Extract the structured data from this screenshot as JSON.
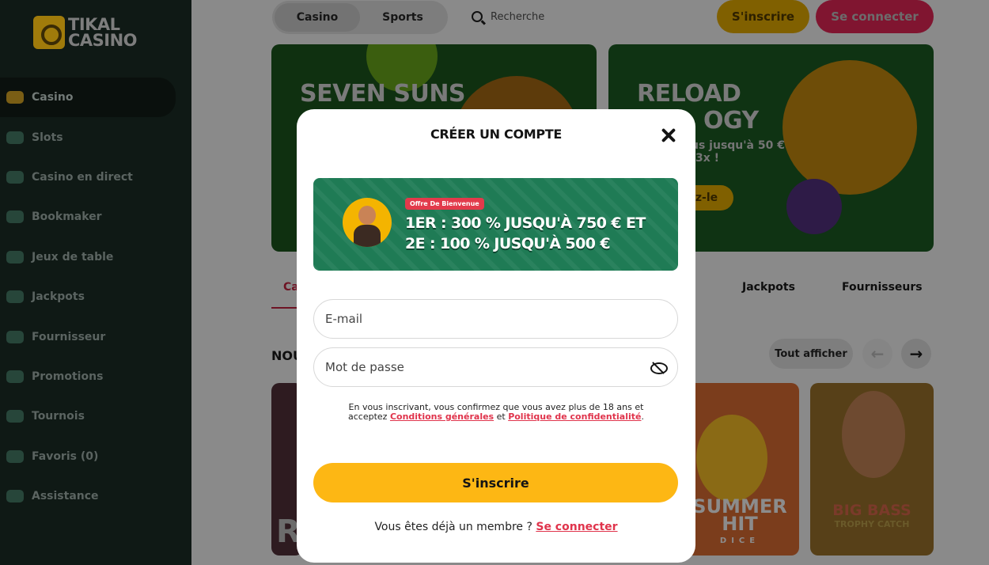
{
  "brand": {
    "logo_line1": "TIKAL",
    "logo_line2": "CASINO"
  },
  "sidebar": {
    "items": [
      {
        "label": "Casino",
        "icon": "slot-machine-icon",
        "active": true
      },
      {
        "label": "Slots",
        "icon": "slots-icon"
      },
      {
        "label": "Casino en direct",
        "icon": "live-casino-icon"
      },
      {
        "label": "Bookmaker",
        "icon": "football-icon"
      },
      {
        "label": "Jeux de table",
        "icon": "cards-icon"
      },
      {
        "label": "Jackpots",
        "icon": "jackpot-icon"
      },
      {
        "label": "Fournisseur",
        "icon": "provider-icon"
      },
      {
        "label": "Promotions",
        "icon": "promotions-icon"
      },
      {
        "label": "Tournois",
        "icon": "megaphone-icon"
      },
      {
        "label": "Favoris (0)",
        "icon": "megaphone-icon"
      },
      {
        "label": "Assistance",
        "icon": "chat-icon"
      }
    ]
  },
  "header": {
    "tabs": [
      "Casino",
      "Sports"
    ],
    "search_placeholder": "Recherche",
    "signup_label": "S'inscrire",
    "login_label": "Se connecter"
  },
  "banners": [
    {
      "title": "SEVEN SUNS"
    },
    {
      "title_line1": "RELOAD",
      "title_line2": "OGY",
      "sub_line1": "us jusqu'à 50 €",
      "sub_line2": "3x !",
      "button": "z-le"
    }
  ],
  "category_tabs": {
    "active_fragment": "Ca",
    "items": [
      "Jackpots",
      "Fournisseurs"
    ]
  },
  "section": {
    "title_fragment": "NOU",
    "see_all": "Tout afficher"
  },
  "games": [
    {
      "name": "R"
    },
    {
      "name_line1": "SUMMER",
      "name_line2": "HIT",
      "name_line3": "DICE"
    },
    {
      "name_line1": "BIG BASS",
      "name_line2": "TROPHY CATCH"
    }
  ],
  "modal": {
    "title": "CRÉER UN COMPTE",
    "promo": {
      "badge": "Offre De Bienvenue",
      "line1": "1ER : 300 % JUSQU'À 750 € ET",
      "line2": "2E : 100 % JUSQU'À 500 €"
    },
    "email_placeholder": "E-mail",
    "password_placeholder": "Mot de passe",
    "terms_before": "En vous inscrivant, vous confirmez que vous avez plus de 18 ans et acceptez ",
    "terms_link1": "Conditions générales",
    "terms_middle": " et ",
    "terms_link2": "Politique de confidentialité",
    "terms_after": ".",
    "submit_label": "S'inscrire",
    "member_text": "Vous êtes déjà un membre ? ",
    "member_link": "Se connecter"
  }
}
